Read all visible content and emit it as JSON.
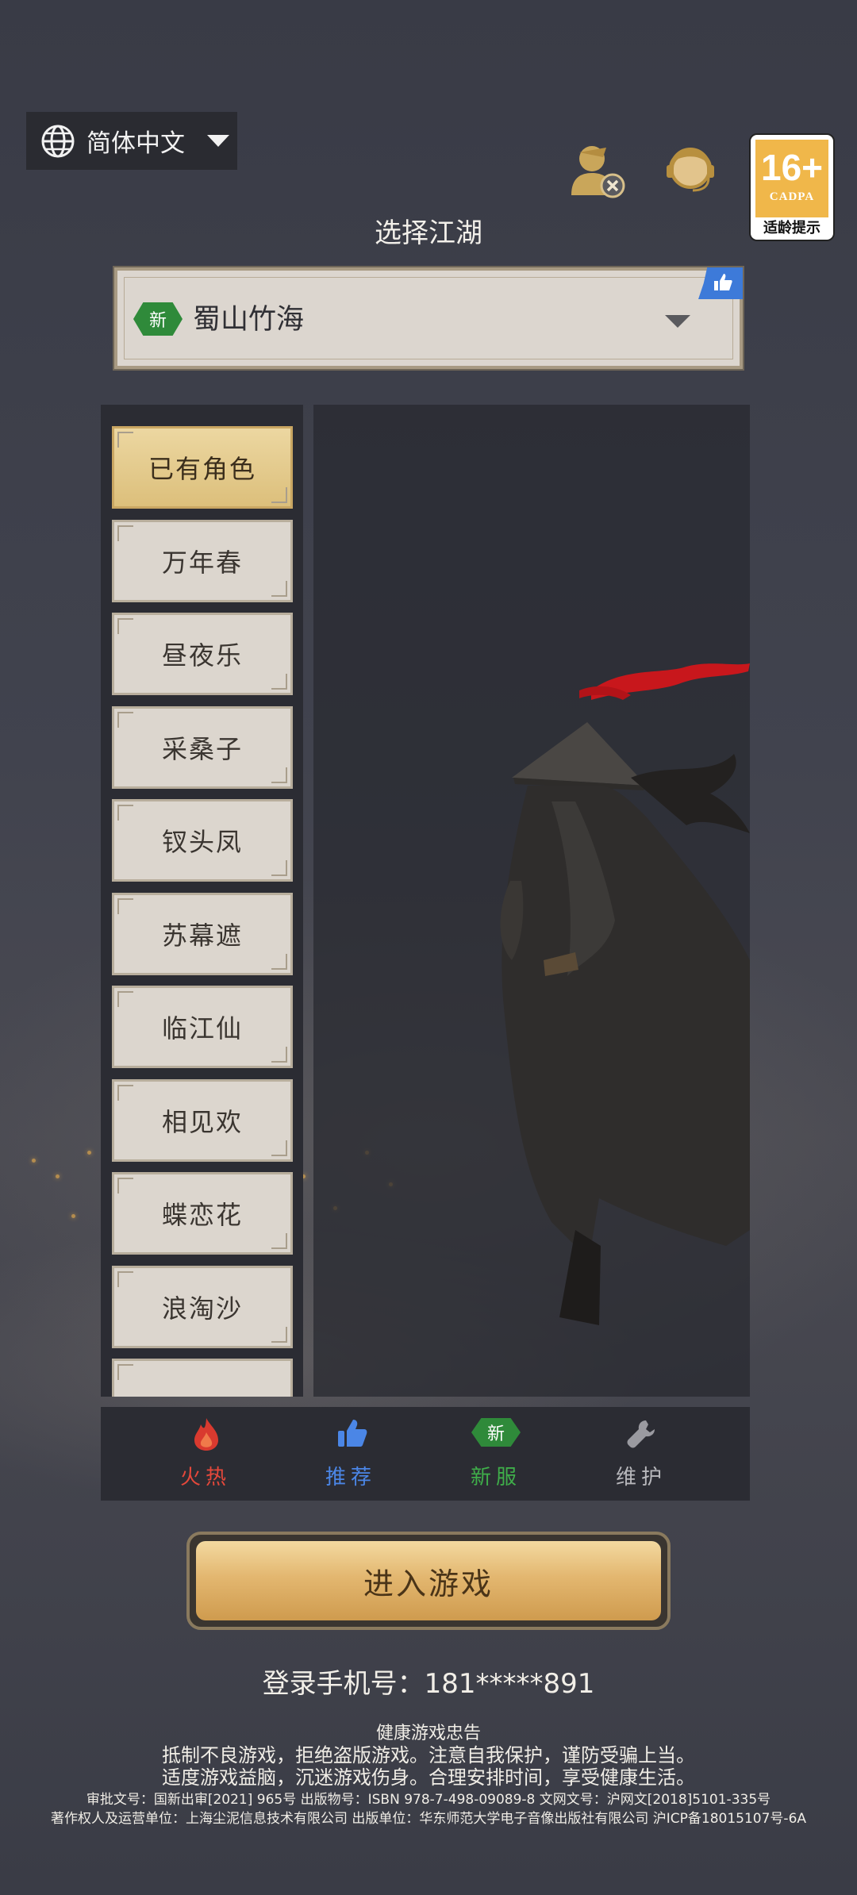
{
  "language_selector": {
    "label": "简体中文",
    "icon": "globe-icon"
  },
  "header": {
    "account_icon": "user-remove-icon",
    "service_icon": "customer-service-icon",
    "age_rating": {
      "value": "16+",
      "org": "CADPA",
      "hint": "适龄提示"
    }
  },
  "title": "选择江湖",
  "server_select": {
    "badge": "新",
    "name": "蜀山竹海",
    "corner_icon": "thumbs-up-icon"
  },
  "server_groups": [
    {
      "label": "已有角色",
      "active": true
    },
    {
      "label": "万年春"
    },
    {
      "label": "昼夜乐"
    },
    {
      "label": "采桑子"
    },
    {
      "label": "钗头凤"
    },
    {
      "label": "苏幕遮"
    },
    {
      "label": "临江仙"
    },
    {
      "label": "相见欢"
    },
    {
      "label": "蝶恋花"
    },
    {
      "label": "浪淘沙"
    }
  ],
  "legend_tabs": [
    {
      "label": "火热",
      "icon": "fire-icon",
      "color": "#e5483b"
    },
    {
      "label": "推荐",
      "icon": "thumbs-up-icon",
      "color": "#4b86e6"
    },
    {
      "label": "新服",
      "icon": "new-badge-icon",
      "color": "#3fae4a",
      "badge": "新"
    },
    {
      "label": "维护",
      "icon": "wrench-icon",
      "color": "#b8b8bc"
    }
  ],
  "enter_button": "进入游戏",
  "phone_text": "登录手机号：181*****891",
  "notice": {
    "title": "健康游戏忠告",
    "line1": "抵制不良游戏，拒绝盗版游戏。注意自我保护，谨防受骗上当。",
    "line2": "适度游戏益脑，沉迷游戏伤身。合理安排时间，享受健康生活。",
    "line3": "审批文号：国新出审[2021] 965号    出版物号：ISBN 978-7-498-09089-8    文网文号：沪网文[2018]5101-335号",
    "line4": "著作权人及运营单位：上海尘泥信息技术有限公司     出版单位：华东师范大学电子音像出版社有限公司     沪ICP备18015107号-6A"
  }
}
